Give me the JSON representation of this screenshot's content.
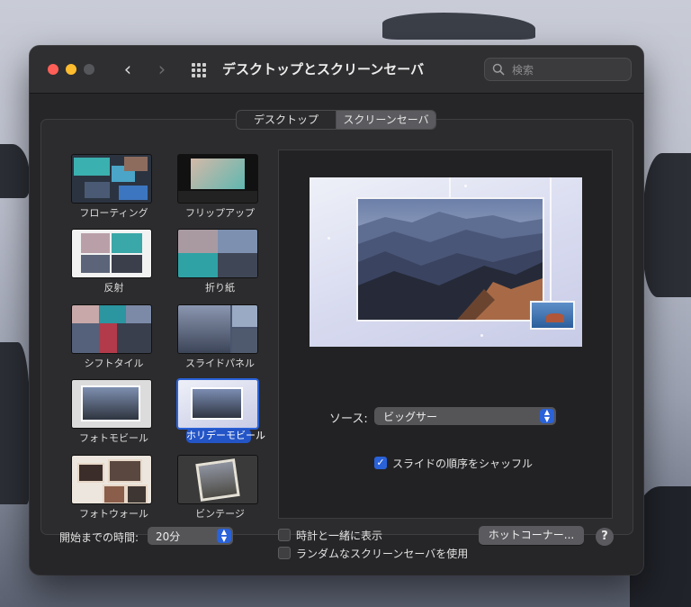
{
  "window": {
    "title": "デスクトップとスクリーンセーバ",
    "back_glyph": "‹",
    "forward_glyph": "›",
    "search_placeholder": "検索"
  },
  "tabs": [
    {
      "label": "デスクトップ",
      "selected": false
    },
    {
      "label": "スクリーンセーバ",
      "selected": true
    }
  ],
  "savers": [
    {
      "label": "フローティング",
      "selected": false
    },
    {
      "label": "フリップアップ",
      "selected": false
    },
    {
      "label": "反射",
      "selected": false
    },
    {
      "label": "折り紙",
      "selected": false
    },
    {
      "label": "シフトタイル",
      "selected": false
    },
    {
      "label": "スライドパネル",
      "selected": false
    },
    {
      "label": "フォトモビール",
      "selected": false
    },
    {
      "label": "ホリデーモビール",
      "selected": true
    },
    {
      "label": "フォトウォール",
      "selected": false
    },
    {
      "label": "ビンテージ",
      "selected": false
    }
  ],
  "source": {
    "label": "ソース:",
    "value": "ビッグサー"
  },
  "shuffle": {
    "label": "スライドの順序をシャッフル",
    "checked": true
  },
  "start": {
    "label": "開始までの時間:",
    "value": "20分"
  },
  "show_clock": {
    "label": "時計と一緒に表示",
    "checked": false
  },
  "random": {
    "label": "ランダムなスクリーンセーバを使用",
    "checked": false
  },
  "hot_corners_label": "ホットコーナー...",
  "help_label": "?",
  "colors": {
    "accent": "#2a62d9",
    "window_bg": "#262628",
    "selection": "#2455c7"
  }
}
